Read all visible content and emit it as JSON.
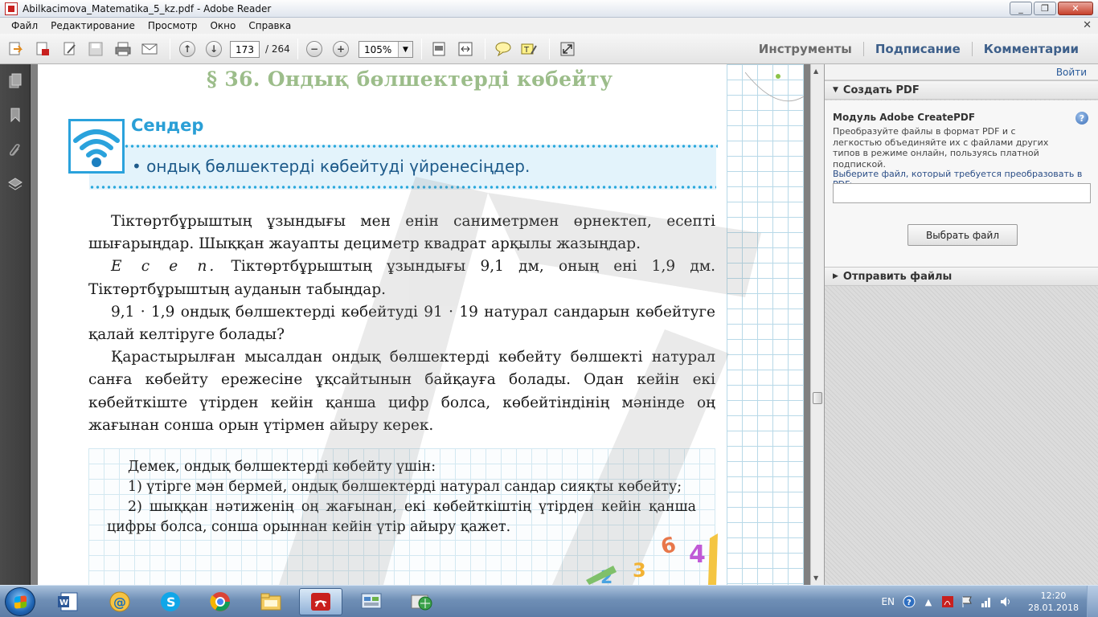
{
  "window": {
    "title": "Abilkacimova_Matematika_5_kz.pdf - Adobe Reader"
  },
  "menu": [
    "Файл",
    "Редактирование",
    "Просмотр",
    "Окно",
    "Справка"
  ],
  "toolbar": {
    "page_current": "173",
    "page_total": "/ 264",
    "zoom": "105%",
    "tools": "Инструменты",
    "sign": "Подписание",
    "comments": "Комментарии"
  },
  "document": {
    "section_title": "§ 36. Ондық бөлшектерді көбейту",
    "you_label": "Сендер",
    "goal": "• ондық бөлшектерді көбейтуді үйренесіңдер.",
    "paragraphs": [
      "Тіктөртбұрыштың ұзындығы мен енін саниметрмен өрнектеп, есепті шығарыңдар. Шыққан жауапты дециметр квадрат арқылы жазыңдар.",
      "Тіктөртбұрыштың ұзындығы 9,1 дм, оның ені 1,9 дм. Тіктөртбұрыштың ауданын табыңдар.",
      "9,1 · 1,9 ондық бөлшектерді көбейтуді 91 · 19 натурал сандарын көбейтуге қалай келтіруге болады?",
      "Қарастырылған мысалдан ондық бөлшектерді көбейту бөлшекті натурал санға көбейту ережесіне ұқсайтынын байқауға болады. Одан кейін екі көбейткіште үтірден кейін қанша цифр болса, көбейтіндінің мәнінде оң жағынан сонша орын үтірмен айыру керек."
    ],
    "example_label": "Е с е п.",
    "rule_intro": "Демек, ондық бөлшектерді көбейту үшін:",
    "rule_items": [
      "1) үтірге мән бермей, ондық бөлшектерді натурал сандар сияқты көбейту;",
      "2) шыққан нәтиженің оң жағынан, екі көбейткіштің үтірден кейін қанша цифры болса, сонша орыннан кейін үтір айыру қажет."
    ]
  },
  "right_panel": {
    "login": "Войти",
    "section_create": "Создать PDF",
    "module_title": "Модуль Adobe CreatePDF",
    "module_desc": "Преобразуйте файлы в формат PDF и с легкостью объединяйте их с файлами других типов в режиме онлайн, пользуясь платной подпиской.",
    "file_prompt": "Выберите файл, который требуется преобразовать в PDF:",
    "choose_button": "Выбрать файл",
    "section_send": "Отправить файлы"
  },
  "taskbar": {
    "lang": "EN",
    "time": "12:20",
    "date": "28.01.2018"
  },
  "colors": {
    "accent_blue": "#2aa2dc",
    "section_green": "#9cbd8a"
  }
}
